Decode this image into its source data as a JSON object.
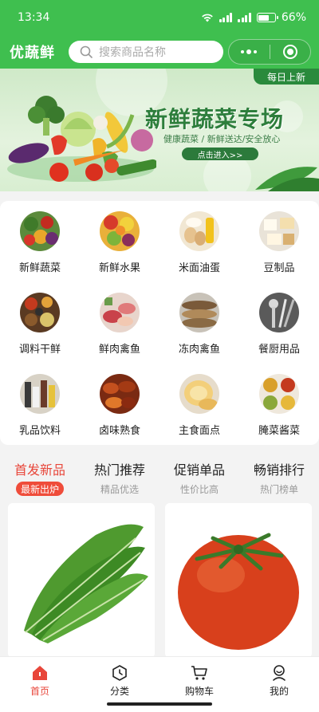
{
  "status_bar": {
    "time": "13:34",
    "battery": "66%",
    "battery_level": 0.66
  },
  "header": {
    "brand": "优蔬鲜",
    "search_placeholder": "搜索商品名称"
  },
  "banner": {
    "tag": "每日上新",
    "title": "新鲜蔬菜专场",
    "subtitle": "健康蔬菜 / 新鲜送达/安全放心",
    "button": "点击进入>>"
  },
  "categories": [
    {
      "label": "新鲜蔬菜"
    },
    {
      "label": "新鲜水果"
    },
    {
      "label": "米面油蛋"
    },
    {
      "label": "豆制品"
    },
    {
      "label": "调料干鲜"
    },
    {
      "label": "鲜肉禽鱼"
    },
    {
      "label": "冻肉禽鱼"
    },
    {
      "label": "餐厨用品"
    },
    {
      "label": "乳品饮料"
    },
    {
      "label": "卤味熟食"
    },
    {
      "label": "主食面点"
    },
    {
      "label": "腌菜酱菜"
    }
  ],
  "tabs": [
    {
      "title": "首发新品",
      "sub": "最新出炉",
      "active": true
    },
    {
      "title": "热门推荐",
      "sub": "精品优选"
    },
    {
      "title": "促销单品",
      "sub": "性价比高"
    },
    {
      "title": "畅销排行",
      "sub": "热门榜单"
    }
  ],
  "products": [
    {
      "icon": "leafy-greens-photo"
    },
    {
      "icon": "tomato-photo"
    }
  ],
  "bottom_nav": [
    {
      "label": "首页",
      "icon": "home-icon",
      "active": true
    },
    {
      "label": "分类",
      "icon": "category-icon"
    },
    {
      "label": "购物车",
      "icon": "cart-icon"
    },
    {
      "label": "我的",
      "icon": "profile-icon"
    }
  ],
  "colors": {
    "brand_green": "#3fbf4f",
    "accent_red": "#e8463a",
    "banner_green": "#2d7e3c"
  }
}
